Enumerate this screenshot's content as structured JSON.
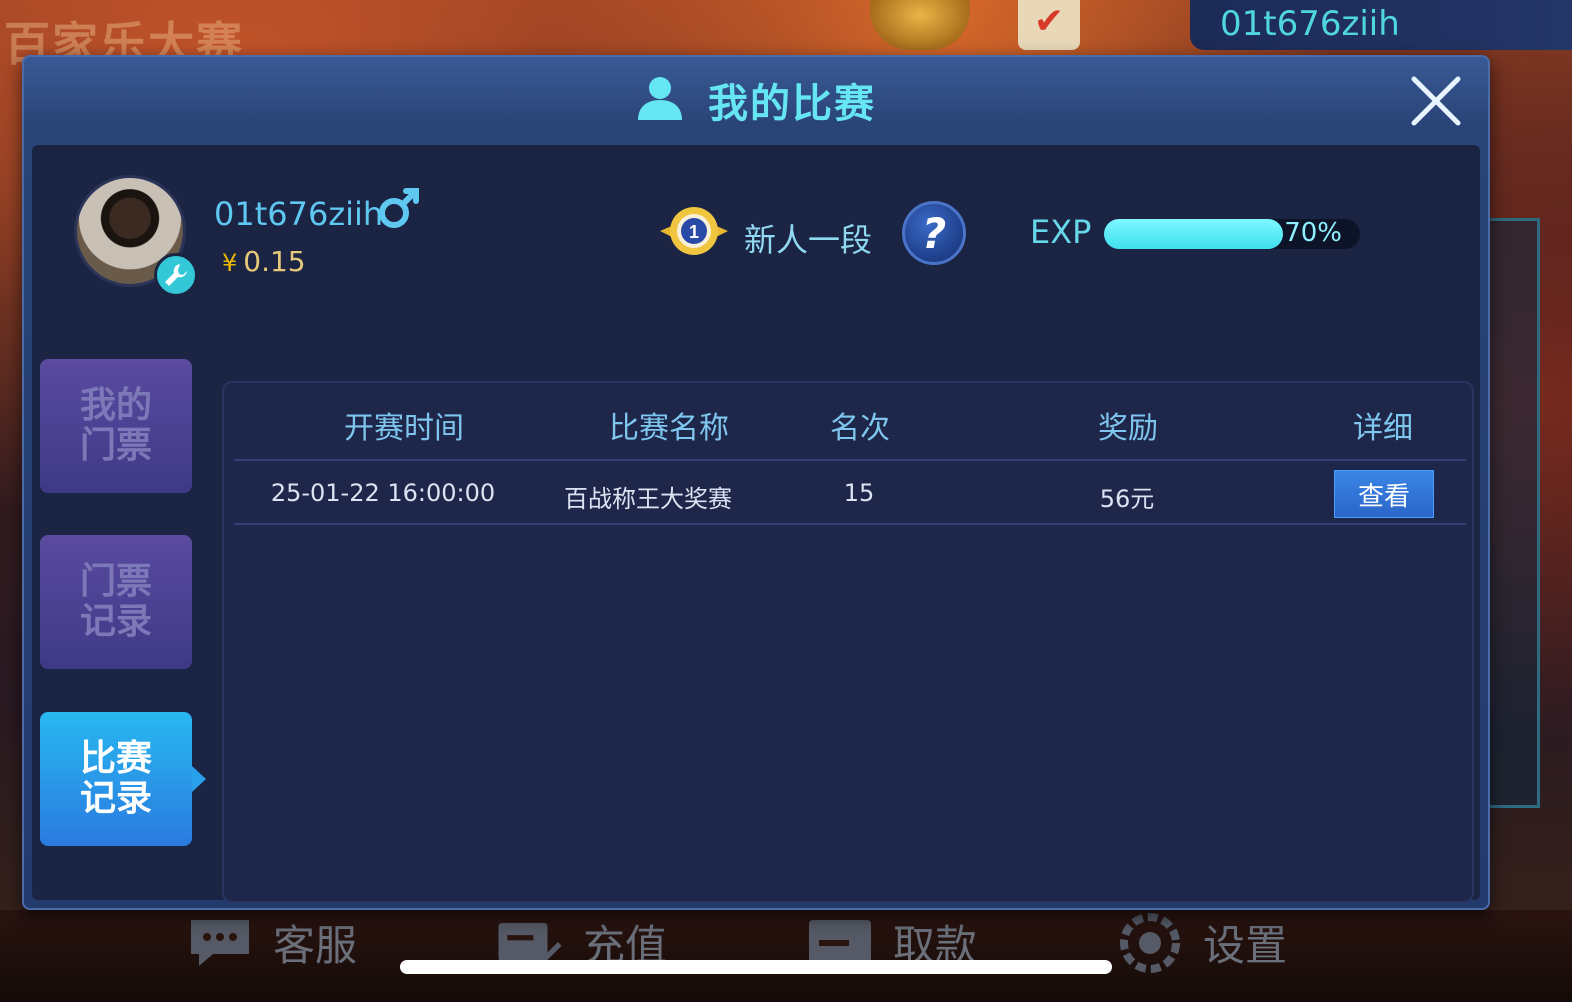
{
  "background": {
    "title": "百家乐大赛",
    "username": "01t676ziih"
  },
  "dialog": {
    "title": "我的比赛",
    "profile": {
      "username": "01t676ziih",
      "currency_symbol": "¥",
      "balance": "0.15",
      "rank_name": "新人一段",
      "rank_level": "1",
      "help_label": "?",
      "exp_label": "EXP",
      "exp_percent_text": "70%",
      "exp_fraction": 0.7
    },
    "tabs": [
      {
        "label": "我的门票",
        "active": false
      },
      {
        "label": "门票记录",
        "active": false
      },
      {
        "label": "比赛记录",
        "active": true
      }
    ],
    "table": {
      "headers": [
        "开赛时间",
        "比赛名称",
        "名次",
        "奖励",
        "详细"
      ],
      "rows": [
        {
          "time": "25-01-22 16:00:00",
          "name": "百战称王大奖赛",
          "rank": "15",
          "reward": "56元",
          "action": "查看"
        }
      ]
    }
  },
  "bottom_nav": [
    {
      "label": "客服",
      "icon": "chat-icon"
    },
    {
      "label": "充值",
      "icon": "recharge-icon"
    },
    {
      "label": "取款",
      "icon": "withdraw-icon"
    },
    {
      "label": "设置",
      "icon": "gear-icon"
    }
  ],
  "colors": {
    "accent_cyan": "#66e6f2",
    "tab_active": "#28b8f0",
    "tab_inactive": "#4a40a0",
    "view_button": "#2a76d8"
  }
}
